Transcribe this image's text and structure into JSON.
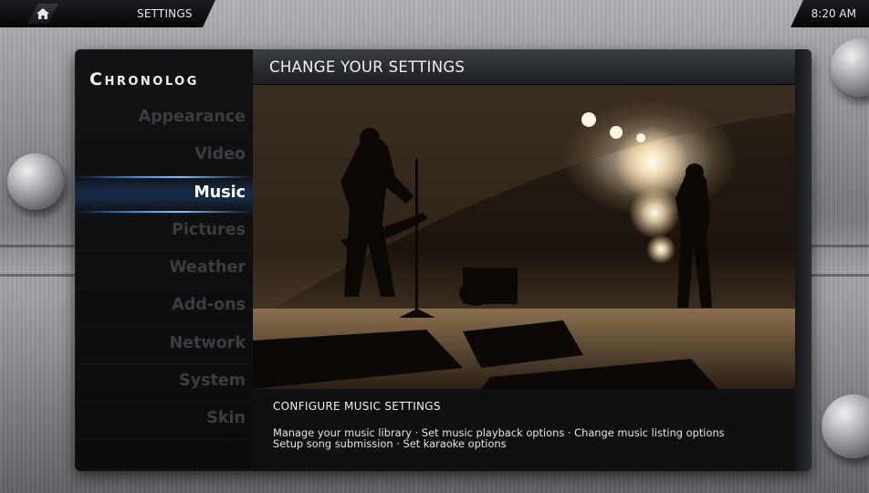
{
  "topbar": {
    "breadcrumb": "SETTINGS",
    "clock": "8:20 AM"
  },
  "sidebar": {
    "logo": "Chronolog",
    "items": [
      {
        "label": "Appearance"
      },
      {
        "label": "Video"
      },
      {
        "label": "Music",
        "active": true
      },
      {
        "label": "Pictures"
      },
      {
        "label": "Weather"
      },
      {
        "label": "Add-ons"
      },
      {
        "label": "Network"
      },
      {
        "label": "System"
      },
      {
        "label": "Skin"
      }
    ]
  },
  "main": {
    "title": "CHANGE YOUR SETTINGS",
    "section_title": "CONFIGURE MUSIC SETTINGS",
    "description_line1": "Manage your music library · Set music playback options · Change music listing options",
    "description_line2": "Setup song submission · Set karaoke options"
  },
  "icons": {
    "home": "home-icon"
  },
  "colors": {
    "accent": "#3f8fe6",
    "inactive_text": "#3b3d41",
    "active_text": "#ffffff"
  }
}
